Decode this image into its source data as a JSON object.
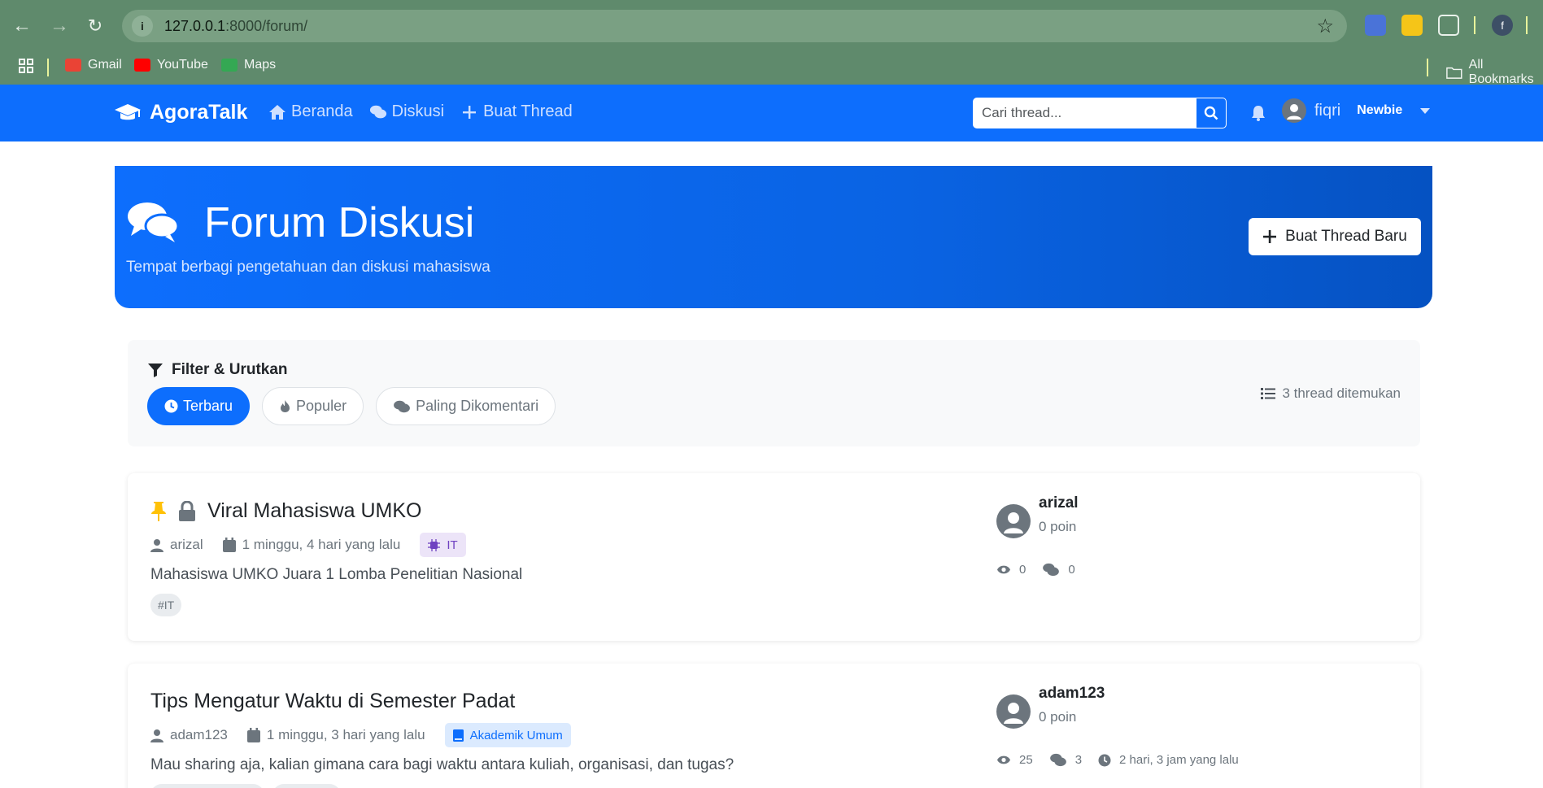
{
  "browser": {
    "url_host": "127.0.0.1",
    "url_path": ":8000/forum/",
    "bookmarks": [
      {
        "label": "Gmail",
        "color": "#ea4335"
      },
      {
        "label": "YouTube",
        "color": "#ff0000"
      },
      {
        "label": "Maps",
        "color": "#34a853"
      }
    ],
    "all_bookmarks": "All Bookmarks",
    "profile_initial": "f"
  },
  "navbar": {
    "brand": "AgoraTalk",
    "links": [
      "Beranda",
      "Diskusi",
      "Buat Thread"
    ],
    "search_placeholder": "Cari thread...",
    "user_name": "fiqri",
    "user_rank": "Newbie"
  },
  "hero": {
    "title": "Forum Diskusi",
    "subtitle": "Tempat berbagi pengetahuan dan diskusi mahasiswa",
    "new_thread_button": "Buat Thread Baru"
  },
  "filter": {
    "title": "Filter & Urutkan",
    "options": [
      "Terbaru",
      "Populer",
      "Paling Dikomentari"
    ],
    "active": "Terbaru",
    "count_text": "3 thread ditemukan"
  },
  "threads": [
    {
      "title": "Viral Mahasiswa UMKO",
      "pinned": true,
      "locked": true,
      "author": "arizal",
      "time": "1 minggu, 4 hari yang lalu",
      "category": "IT",
      "category_color": "#6f42c1",
      "excerpt": "Mahasiswa UMKO Juara 1 Lomba Penelitian Nasional",
      "tags": [
        "#IT"
      ],
      "author_points": "0 poin",
      "views": "0",
      "comments": "0",
      "last_activity": ""
    },
    {
      "title": "Tips Mengatur Waktu di Semester Padat",
      "pinned": false,
      "locked": false,
      "author": "adam123",
      "time": "1 minggu, 3 hari yang lalu",
      "category": "Akademik Umum",
      "category_color": "#0d6efd",
      "excerpt": "Mau sharing aja, kalian gimana cara bagi waktu antara kuliah, organisasi, dan tugas?",
      "tags": [],
      "author_points": "0 poin",
      "views": "25",
      "comments": "3",
      "last_activity": "2 hari, 3 jam yang lalu"
    }
  ]
}
